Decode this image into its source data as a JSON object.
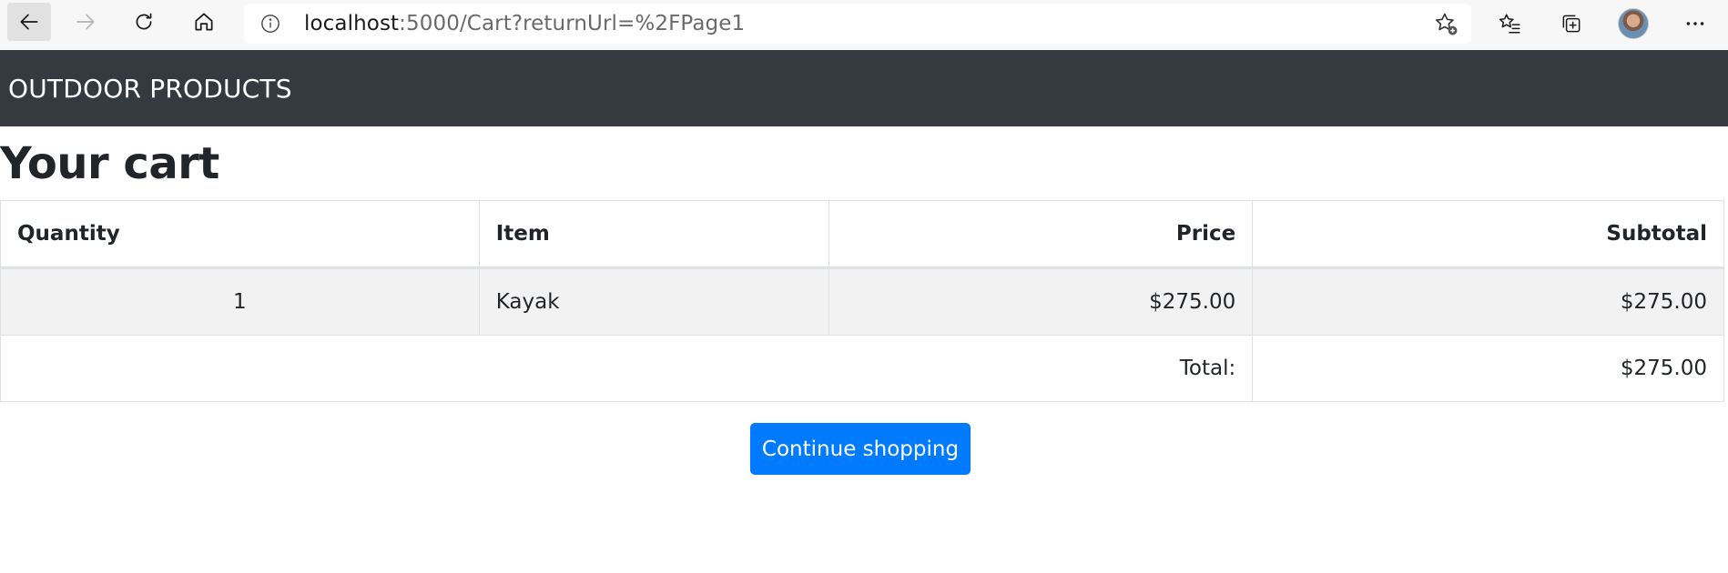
{
  "browser": {
    "url_host": "localhost",
    "url_rest": ":5000/Cart?returnUrl=%2FPage1",
    "icons": {
      "back": "back-arrow-icon",
      "forward": "forward-arrow-icon",
      "reload": "reload-icon",
      "home": "home-icon",
      "info": "info-icon",
      "add_favorite": "star-plus-icon",
      "favorites": "favorites-list-icon",
      "collections": "collections-icon",
      "more": "more-dots-icon"
    }
  },
  "navbar": {
    "brand": "OUTDOOR PRODUCTS",
    "background": "#343a40"
  },
  "page": {
    "title": "Your cart"
  },
  "cart_table": {
    "headers": [
      "Quantity",
      "Item",
      "Price",
      "Subtotal"
    ],
    "rows": [
      {
        "quantity": "1",
        "item": "Kayak",
        "price": "$275.00",
        "subtotal": "$275.00"
      }
    ],
    "total_label": "Total:",
    "total_value": "$275.00"
  },
  "actions": {
    "continue_label": "Continue shopping",
    "accent_color": "#007bff"
  }
}
